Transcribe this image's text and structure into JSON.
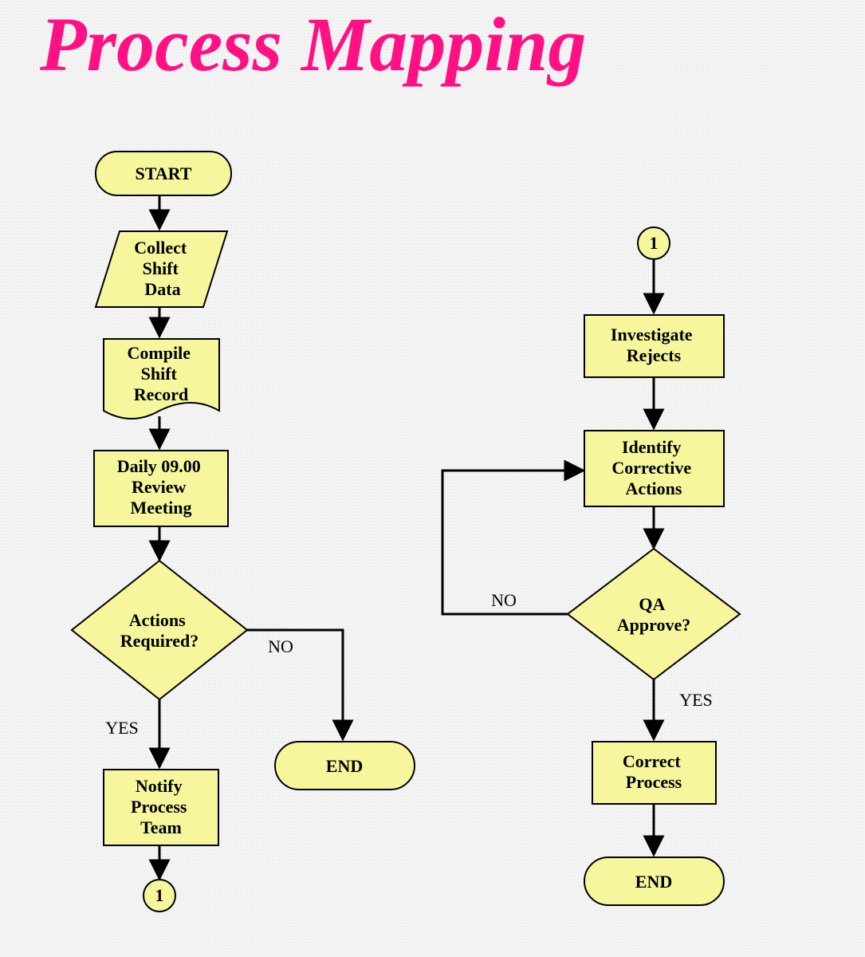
{
  "title": "Process Mapping",
  "nodes": {
    "start": "START",
    "collect": "Collect\nShift\nData",
    "compile": "Compile\nShift\nRecord",
    "meeting": "Daily 09.00\nReview\nMeeting",
    "actions_required": "Actions\nRequired?",
    "notify": "Notify\nProcess\nTeam",
    "end_left": "END",
    "connector_left": "1",
    "connector_right": "1",
    "investigate": "Investigate\nRejects",
    "identify": "Identify\nCorrective\nActions",
    "qa_approve": "QA\nApprove?",
    "correct": "Correct\nProcess",
    "end_right": "END"
  },
  "labels": {
    "yes": "YES",
    "no": "NO"
  },
  "colors": {
    "node_fill": "#f6f69d",
    "title": "#ff1083"
  }
}
